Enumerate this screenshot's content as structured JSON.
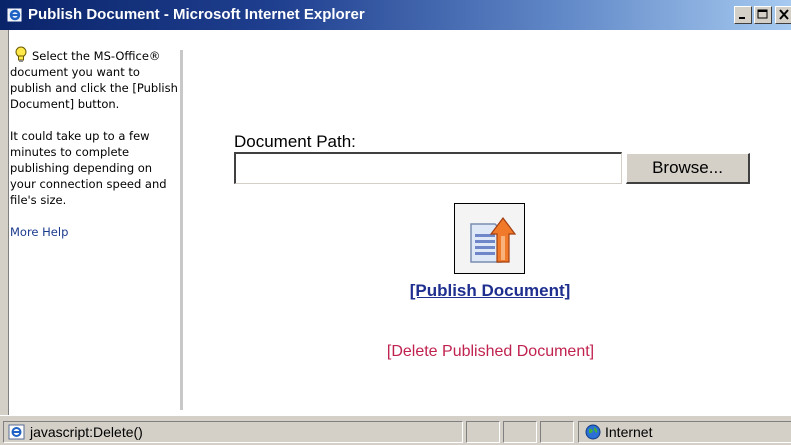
{
  "window": {
    "title": "Publish Document - Microsoft Internet Explorer"
  },
  "sidebar": {
    "instruction": "Select the MS-Office® document you want to publish and click the [Publish Document] button.",
    "note": "It could take up to a few minutes to complete publishing depending on your connection speed and file's size.",
    "help_link": "More Help"
  },
  "form": {
    "path_label": "Document Path:",
    "path_value": "",
    "browse_label": "Browse...",
    "publish_label": "[Publish Document]",
    "delete_label": "[Delete Published Document]"
  },
  "statusbar": {
    "status_text": "javascript:Delete()",
    "zone_label": "Internet"
  },
  "colors": {
    "titlebar_start": "#0a246a",
    "titlebar_end": "#a6caf0",
    "publish_link": "#1f2f8f",
    "delete_link": "#c0224f",
    "help_link": "#1a3a8c"
  }
}
